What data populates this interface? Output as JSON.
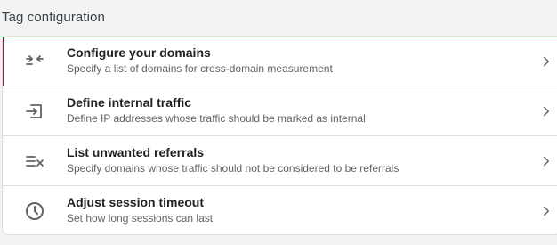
{
  "section": {
    "title": "Tag configuration"
  },
  "rows": [
    {
      "icon": "arrows-merge-icon",
      "title": "Configure your domains",
      "description": "Specify a list of domains for cross-domain measurement",
      "highlighted": true
    },
    {
      "icon": "login-arrow-icon",
      "title": "Define internal traffic",
      "description": "Define IP addresses whose traffic should be marked as internal",
      "highlighted": false
    },
    {
      "icon": "list-remove-icon",
      "title": "List unwanted referrals",
      "description": "Specify domains whose traffic should not be considered to be referrals",
      "highlighted": false
    },
    {
      "icon": "clock-icon",
      "title": "Adjust session timeout",
      "description": "Set how long sessions can last",
      "highlighted": false
    }
  ],
  "colors": {
    "page_background": "#f1f3f4",
    "card_background": "#ffffff",
    "highlight_border": "#b3141f",
    "icon_color": "#5f6368"
  }
}
